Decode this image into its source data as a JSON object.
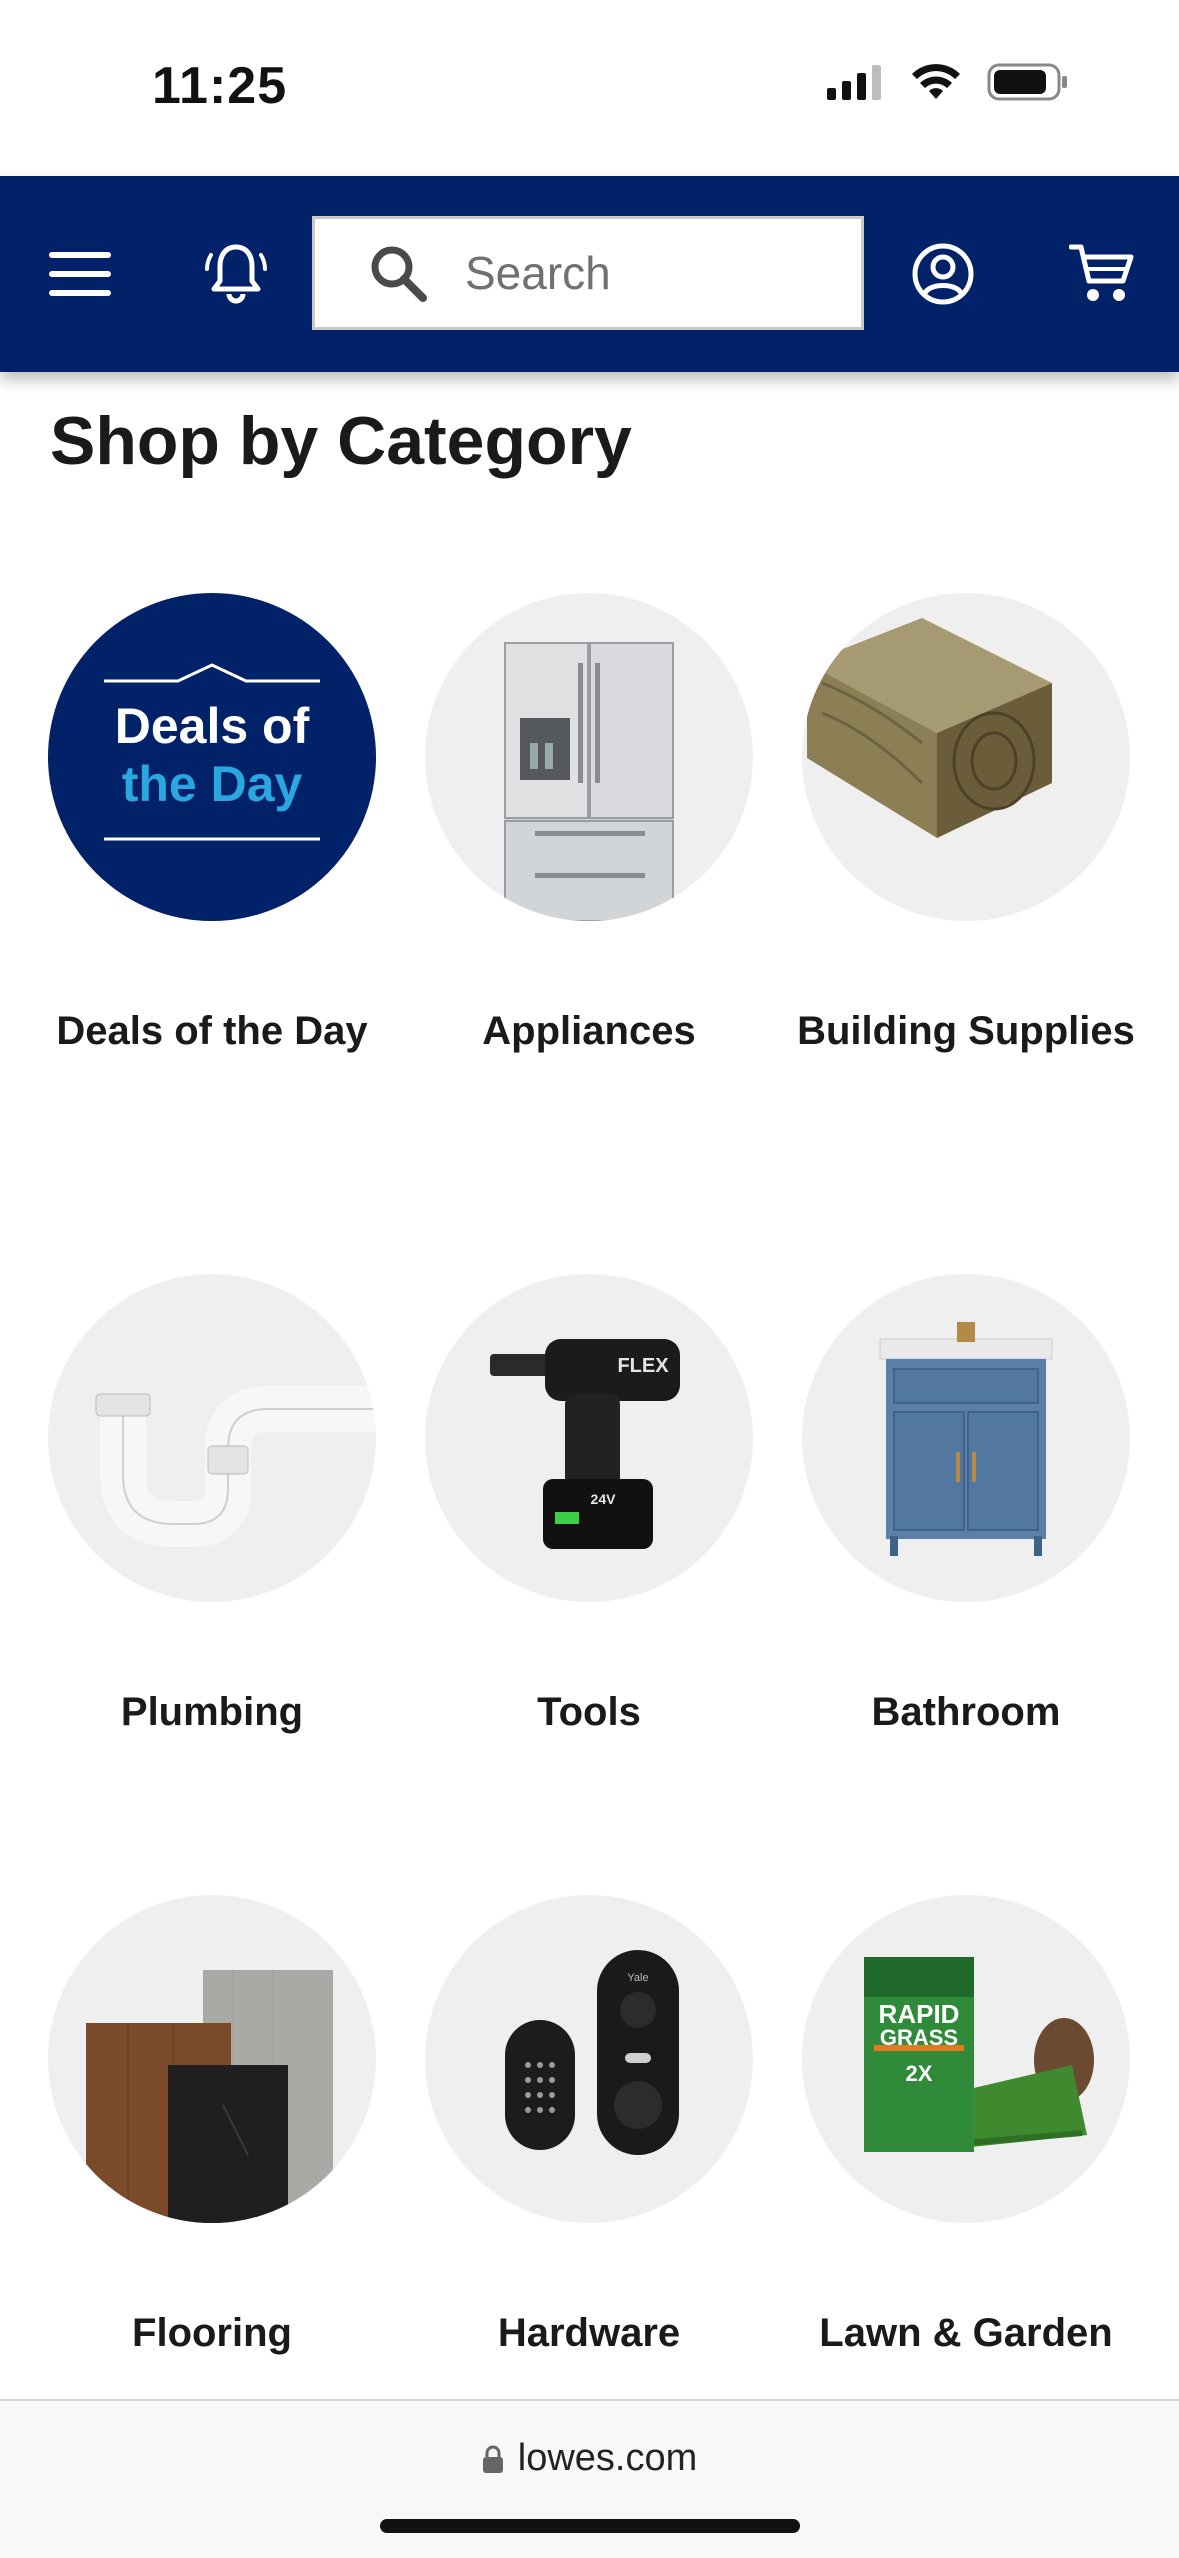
{
  "status_bar": {
    "time": "11:25"
  },
  "header": {
    "search_placeholder": "Search",
    "icons": [
      "menu-icon",
      "bell-icon",
      "search-icon",
      "account-icon",
      "cart-icon"
    ],
    "bg_color": "#012169"
  },
  "page": {
    "title": "Shop by Category"
  },
  "deals_badge": {
    "line1": "Deals of",
    "line2": "the Day"
  },
  "categories": [
    {
      "label": "Deals of the Day"
    },
    {
      "label": "Appliances"
    },
    {
      "label": "Building Supplies"
    },
    {
      "label": "Plumbing"
    },
    {
      "label": "Tools"
    },
    {
      "label": "Bathroom"
    },
    {
      "label": "Flooring"
    },
    {
      "label": "Hardware"
    },
    {
      "label": "Lawn & Garden"
    }
  ],
  "product_marks": {
    "drill_brand": "FLEX",
    "drill_voltage": "24V",
    "lock_brand": "Yale",
    "grass_line1": "RAPID",
    "grass_line2": "GRASS",
    "grass_tag": "2X"
  },
  "browser": {
    "url": "lowes.com"
  }
}
